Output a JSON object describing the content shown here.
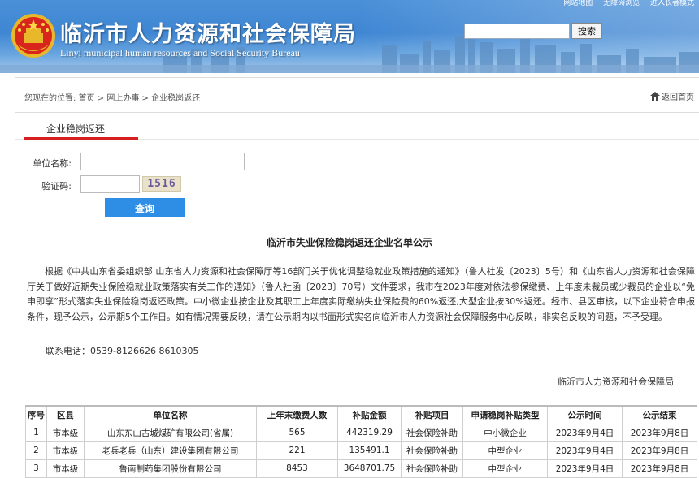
{
  "header": {
    "title_cn": "临沂市人力资源和社会保障局",
    "title_en": "Linyi municipal human resources and Social Security Bureau",
    "top_links": [
      "网站地图",
      "无障碍浏览",
      "进入长者模式"
    ],
    "search_button": "搜索",
    "search_value": ""
  },
  "breadcrumb": {
    "prefix": "您现在的位置:",
    "items": [
      "首页",
      "网上办事",
      "企业稳岗返还"
    ],
    "separator": ">",
    "back_label": "返回首页"
  },
  "tab": {
    "label": "企业稳岗返还"
  },
  "form": {
    "name_label": "单位名称:",
    "name_value": "",
    "code_label": "验证码:",
    "code_value": "",
    "captcha": "1516",
    "query_button": "查询"
  },
  "notice": {
    "title": "临沂市失业保险稳岗返还企业名单公示",
    "body": "根据《中共山东省委组织部 山东省人力资源和社会保障厅等16部门关于优化调整稳就业政策措施的通知》（鲁人社发〔2023〕5号）和《山东省人力资源和社会保障厅关于做好近期失业保险稳就业政策落实有关工作的通知》（鲁人社函〔2023〕70号）文件要求，我市在2023年度对依法参保缴费、上年度未裁员或少裁员的企业以“免申即享”形式落实失业保险稳岗返还政策。中小微企业按企业及其职工上年度实际缴纳失业保险费的60%返还,大型企业按30%返还。经市、县区审核，以下企业符合申报条件，现予公示，公示期5个工作日。如有情况需要反映，请在公示期内以书面形式实名向临沂市人力资源社会保障服务中心反映，非实名反映的问题，不予受理。",
    "phone": "联系电话：0539-8126626 8610305",
    "org": "临沂市人力资源和社会保障局"
  },
  "table": {
    "headers": [
      "序号",
      "区县",
      "单位名称",
      "上年末缴费人数",
      "补贴金额",
      "补贴项目",
      "申请稳岗补贴类型",
      "公示时间",
      "公示结束"
    ],
    "rows": [
      [
        "1",
        "市本级",
        "山东东山古城煤矿有限公司(省属)",
        "565",
        "442319.29",
        "社会保险补助",
        "中小微企业",
        "2023年9月4日",
        "2023年9月8日"
      ],
      [
        "2",
        "市本级",
        "老兵老兵（山东）建设集团有限公司",
        "221",
        "135491.1",
        "社会保险补助",
        "中型企业",
        "2023年9月4日",
        "2023年9月8日"
      ],
      [
        "3",
        "市本级",
        "鲁南制药集团股份有限公司",
        "8453",
        "3648701.75",
        "社会保险补助",
        "中型企业",
        "2023年9月4日",
        "2023年9月8日"
      ]
    ]
  },
  "colors": {
    "banner": "#4a90d8",
    "accent_red": "#d62020",
    "button_blue": "#2e8ee6"
  }
}
